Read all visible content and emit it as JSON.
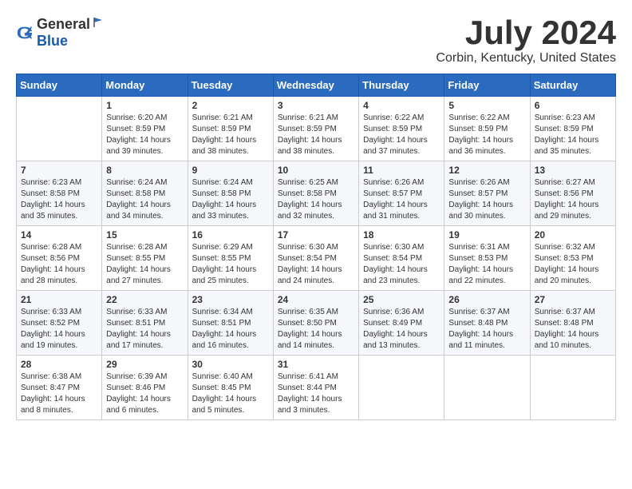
{
  "header": {
    "logo_general": "General",
    "logo_blue": "Blue",
    "title": "July 2024",
    "subtitle": "Corbin, Kentucky, United States"
  },
  "calendar": {
    "days_of_week": [
      "Sunday",
      "Monday",
      "Tuesday",
      "Wednesday",
      "Thursday",
      "Friday",
      "Saturday"
    ],
    "weeks": [
      [
        {
          "day": "",
          "info": ""
        },
        {
          "day": "1",
          "info": "Sunrise: 6:20 AM\nSunset: 8:59 PM\nDaylight: 14 hours\nand 39 minutes."
        },
        {
          "day": "2",
          "info": "Sunrise: 6:21 AM\nSunset: 8:59 PM\nDaylight: 14 hours\nand 38 minutes."
        },
        {
          "day": "3",
          "info": "Sunrise: 6:21 AM\nSunset: 8:59 PM\nDaylight: 14 hours\nand 38 minutes."
        },
        {
          "day": "4",
          "info": "Sunrise: 6:22 AM\nSunset: 8:59 PM\nDaylight: 14 hours\nand 37 minutes."
        },
        {
          "day": "5",
          "info": "Sunrise: 6:22 AM\nSunset: 8:59 PM\nDaylight: 14 hours\nand 36 minutes."
        },
        {
          "day": "6",
          "info": "Sunrise: 6:23 AM\nSunset: 8:59 PM\nDaylight: 14 hours\nand 35 minutes."
        }
      ],
      [
        {
          "day": "7",
          "info": "Sunrise: 6:23 AM\nSunset: 8:58 PM\nDaylight: 14 hours\nand 35 minutes."
        },
        {
          "day": "8",
          "info": "Sunrise: 6:24 AM\nSunset: 8:58 PM\nDaylight: 14 hours\nand 34 minutes."
        },
        {
          "day": "9",
          "info": "Sunrise: 6:24 AM\nSunset: 8:58 PM\nDaylight: 14 hours\nand 33 minutes."
        },
        {
          "day": "10",
          "info": "Sunrise: 6:25 AM\nSunset: 8:58 PM\nDaylight: 14 hours\nand 32 minutes."
        },
        {
          "day": "11",
          "info": "Sunrise: 6:26 AM\nSunset: 8:57 PM\nDaylight: 14 hours\nand 31 minutes."
        },
        {
          "day": "12",
          "info": "Sunrise: 6:26 AM\nSunset: 8:57 PM\nDaylight: 14 hours\nand 30 minutes."
        },
        {
          "day": "13",
          "info": "Sunrise: 6:27 AM\nSunset: 8:56 PM\nDaylight: 14 hours\nand 29 minutes."
        }
      ],
      [
        {
          "day": "14",
          "info": "Sunrise: 6:28 AM\nSunset: 8:56 PM\nDaylight: 14 hours\nand 28 minutes."
        },
        {
          "day": "15",
          "info": "Sunrise: 6:28 AM\nSunset: 8:55 PM\nDaylight: 14 hours\nand 27 minutes."
        },
        {
          "day": "16",
          "info": "Sunrise: 6:29 AM\nSunset: 8:55 PM\nDaylight: 14 hours\nand 25 minutes."
        },
        {
          "day": "17",
          "info": "Sunrise: 6:30 AM\nSunset: 8:54 PM\nDaylight: 14 hours\nand 24 minutes."
        },
        {
          "day": "18",
          "info": "Sunrise: 6:30 AM\nSunset: 8:54 PM\nDaylight: 14 hours\nand 23 minutes."
        },
        {
          "day": "19",
          "info": "Sunrise: 6:31 AM\nSunset: 8:53 PM\nDaylight: 14 hours\nand 22 minutes."
        },
        {
          "day": "20",
          "info": "Sunrise: 6:32 AM\nSunset: 8:53 PM\nDaylight: 14 hours\nand 20 minutes."
        }
      ],
      [
        {
          "day": "21",
          "info": "Sunrise: 6:33 AM\nSunset: 8:52 PM\nDaylight: 14 hours\nand 19 minutes."
        },
        {
          "day": "22",
          "info": "Sunrise: 6:33 AM\nSunset: 8:51 PM\nDaylight: 14 hours\nand 17 minutes."
        },
        {
          "day": "23",
          "info": "Sunrise: 6:34 AM\nSunset: 8:51 PM\nDaylight: 14 hours\nand 16 minutes."
        },
        {
          "day": "24",
          "info": "Sunrise: 6:35 AM\nSunset: 8:50 PM\nDaylight: 14 hours\nand 14 minutes."
        },
        {
          "day": "25",
          "info": "Sunrise: 6:36 AM\nSunset: 8:49 PM\nDaylight: 14 hours\nand 13 minutes."
        },
        {
          "day": "26",
          "info": "Sunrise: 6:37 AM\nSunset: 8:48 PM\nDaylight: 14 hours\nand 11 minutes."
        },
        {
          "day": "27",
          "info": "Sunrise: 6:37 AM\nSunset: 8:48 PM\nDaylight: 14 hours\nand 10 minutes."
        }
      ],
      [
        {
          "day": "28",
          "info": "Sunrise: 6:38 AM\nSunset: 8:47 PM\nDaylight: 14 hours\nand 8 minutes."
        },
        {
          "day": "29",
          "info": "Sunrise: 6:39 AM\nSunset: 8:46 PM\nDaylight: 14 hours\nand 6 minutes."
        },
        {
          "day": "30",
          "info": "Sunrise: 6:40 AM\nSunset: 8:45 PM\nDaylight: 14 hours\nand 5 minutes."
        },
        {
          "day": "31",
          "info": "Sunrise: 6:41 AM\nSunset: 8:44 PM\nDaylight: 14 hours\nand 3 minutes."
        },
        {
          "day": "",
          "info": ""
        },
        {
          "day": "",
          "info": ""
        },
        {
          "day": "",
          "info": ""
        }
      ]
    ]
  }
}
